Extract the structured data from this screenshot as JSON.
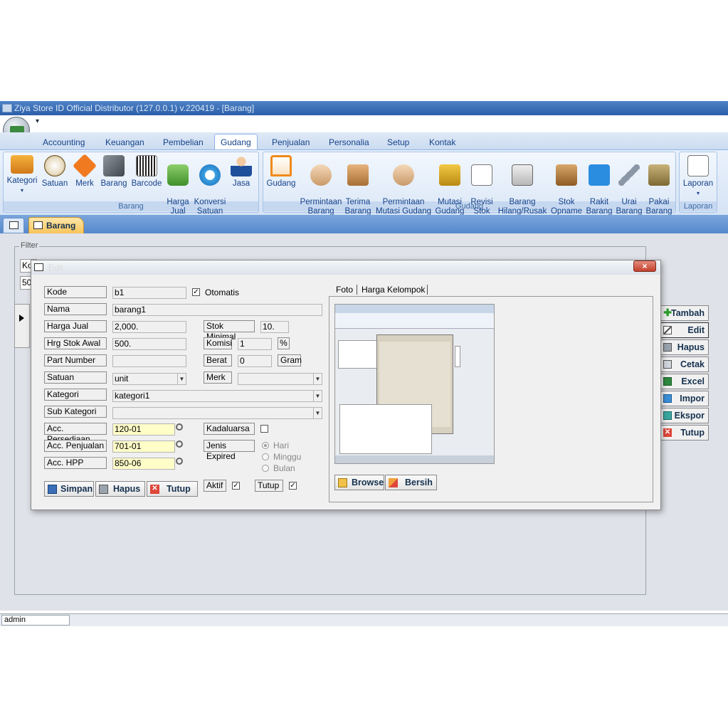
{
  "window": {
    "title": "Ziya Store ID Official Distributor (127.0.0.1) v.220419 - [Barang]"
  },
  "ribbon_tabs": [
    "Accounting",
    "Keuangan",
    "Pembelian",
    "Gudang",
    "Penjualan",
    "Personalia",
    "Setup",
    "Kontak"
  ],
  "ribbon": {
    "barang_group": {
      "label": "Barang",
      "buttons": [
        "Kategori",
        "Satuan",
        "Merk",
        "Barang",
        "Barcode",
        "Harga\nJual",
        "Konversi\nSatuan",
        "Jasa"
      ]
    },
    "gudang_group": {
      "label": "Gudang",
      "buttons": [
        "Gudang",
        "Permintaan\nBarang",
        "Terima\nBarang",
        "Permintaan\nMutasi Gudang",
        "Mutasi\nGudang",
        "Revisi\nStok",
        "Barang\nHilang/Rusak",
        "Stok\nOpname",
        "Rakit\nBarang",
        "Urai\nBarang",
        "Pakai\nBarang"
      ]
    },
    "laporan_group": {
      "label": "Laporan",
      "buttons": [
        "Laporan"
      ]
    }
  },
  "doc_tab": {
    "label": "Barang"
  },
  "filter": {
    "label": "Filter",
    "kode_partial": "Ko",
    "limit_partial": "50"
  },
  "side_buttons": [
    "Tambah",
    "Edit",
    "Hapus",
    "Cetak",
    "Excel",
    "Impor",
    "Ekspor",
    "Tutup"
  ],
  "status": {
    "user": "admin"
  },
  "dialog": {
    "title": "Edit",
    "close": "×",
    "labels": {
      "kode": "Kode",
      "nama": "Nama",
      "harga_jual": "Harga Jual",
      "hrg_stok_awal": "Hrg Stok Awal",
      "part_number": "Part Number",
      "satuan": "Satuan",
      "kategori": "Kategori",
      "sub_kategori": "Sub Kategori",
      "acc_persediaan": "Acc. Persediaan",
      "acc_penjualan": "Acc. Penjualan",
      "acc_hpp": "Acc. HPP",
      "stok_minimal": "Stok Minimal",
      "komisi": "Komisi",
      "berat": "Berat",
      "merk": "Merk",
      "kadaluarsa": "Kadaluarsa",
      "jenis_expired": "Jenis Expired",
      "aktif": "Aktif",
      "tutup": "Tutup",
      "otomatis": "Otomatis",
      "percent": "%",
      "gram": "Gram"
    },
    "values": {
      "kode": "b1",
      "nama": "barang1",
      "harga_jual": "2,000.",
      "hrg_stok_awal": "500.",
      "part_number": "",
      "satuan": "unit",
      "kategori": "kategori1",
      "sub_kategori": "",
      "acc_persediaan": "120-01",
      "acc_penjualan": "701-01",
      "acc_hpp": "850-06",
      "stok_minimal": "10.",
      "komisi": "1",
      "berat": "0",
      "merk": ""
    },
    "checks": {
      "otomatis": true,
      "kadaluarsa": false,
      "aktif": true,
      "tutup": true
    },
    "expired_options": [
      "Hari",
      "Minggu",
      "Bulan"
    ],
    "buttons": {
      "simpan": "Simpan",
      "hapus": "Hapus",
      "tutup": "Tutup"
    },
    "tabs": [
      "Foto",
      "Harga Kelompok"
    ],
    "photo_buttons": {
      "browse": "Browse",
      "bersih": "Bersih"
    }
  },
  "colors": {
    "accent": "#15428b",
    "titlebar": "#3a6fb8",
    "doc_tab": "#f7c45a",
    "yellow_field": "#fffdc8"
  }
}
